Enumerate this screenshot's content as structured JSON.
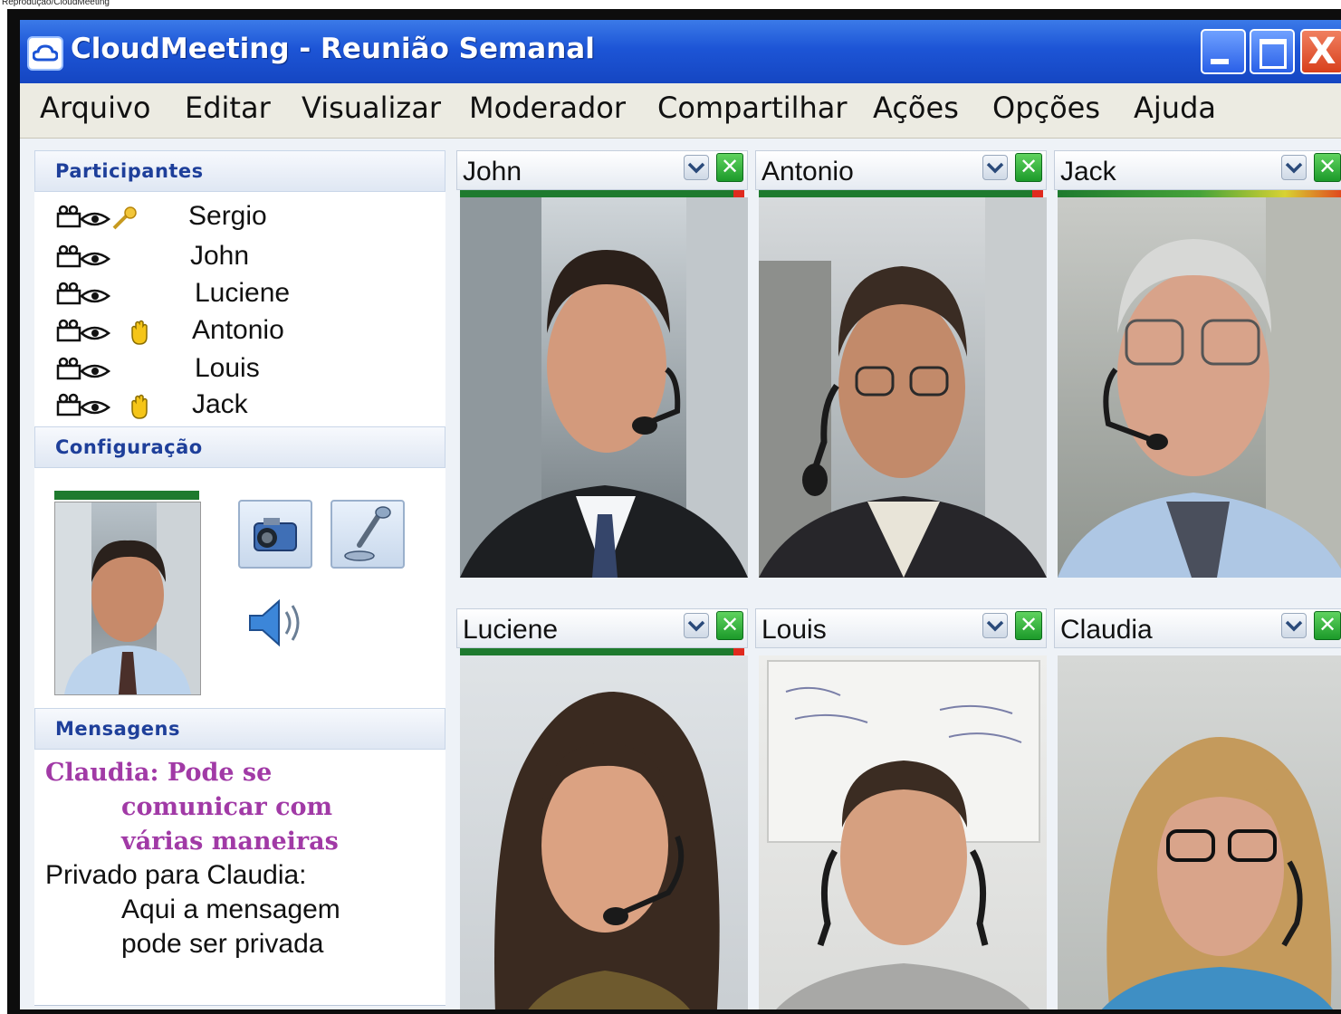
{
  "photo_credit": "Reprodução/CloudMeeting",
  "window": {
    "title": "CloudMeeting - Reunião Semanal",
    "controls": {
      "close_glyph": "X"
    }
  },
  "menu": [
    "Arquivo",
    "Editar",
    "Visualizar",
    "Moderador",
    "Compartilhar",
    "Ações",
    "Opções",
    "Ajuda"
  ],
  "participants_panel": {
    "heading": "Participantes",
    "participants": [
      {
        "name": "Sergio",
        "icons": [
          "camera-icon",
          "eye-icon",
          "key-icon"
        ]
      },
      {
        "name": "John",
        "icons": [
          "camera-icon",
          "eye-icon"
        ]
      },
      {
        "name": "Luciene",
        "icons": [
          "camera-icon",
          "eye-icon"
        ]
      },
      {
        "name": "Antonio",
        "icons": [
          "camera-icon",
          "eye-icon",
          "raised-hand-icon"
        ]
      },
      {
        "name": "Louis",
        "icons": [
          "camera-icon",
          "eye-icon"
        ]
      },
      {
        "name": "Jack",
        "icons": [
          "camera-icon",
          "eye-icon",
          "raised-hand-icon"
        ]
      }
    ]
  },
  "config_panel": {
    "heading": "Configuração",
    "buttons": [
      "camera-button",
      "microphone-button",
      "speaker-button"
    ]
  },
  "messages_panel": {
    "heading": "Mensagens",
    "claudia_message": [
      "Claudia: Pode se",
      "comunicar com",
      "várias maneiras"
    ],
    "private_message": [
      "Privado para Claudia:",
      "Aqui a mensagem",
      "pode ser privada"
    ]
  },
  "video_tiles": [
    {
      "name": "John"
    },
    {
      "name": "Antonio"
    },
    {
      "name": "Jack"
    },
    {
      "name": "Luciene"
    },
    {
      "name": "Louis"
    },
    {
      "name": "Claudia"
    }
  ],
  "colors": {
    "titlebar": "#1d55d6",
    "heading_text": "#1e3f9a",
    "claudia_text": "#a13aa6",
    "level_meter": "#1e7a2e",
    "close_tile": "#1c9a2a"
  }
}
